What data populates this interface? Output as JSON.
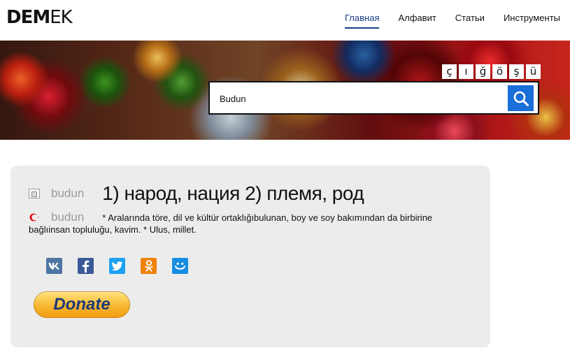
{
  "header": {
    "logo_bold": "DEM",
    "logo_light": "EK",
    "nav": [
      {
        "label": "Главная",
        "active": true
      },
      {
        "label": "Алфавит",
        "active": false
      },
      {
        "label": "Статьи",
        "active": false
      },
      {
        "label": "Инструменты",
        "active": false
      }
    ]
  },
  "special_letters": [
    "ç",
    "ı",
    "ğ",
    "ö",
    "ş",
    "ü"
  ],
  "search": {
    "value": "Budun",
    "button_icon": "search-icon"
  },
  "entry": {
    "ru_word": "budun",
    "ru_translation": "1) народ, нация 2) племя, род",
    "tr_word": "budun",
    "tr_definition": "* Aralarında töre, dil ve kültür ortaklığıbulunan, boy ve soy bakımından da birbirine bağlıinsan topluluğu, kavim. * Ulus, millet."
  },
  "social": [
    {
      "name": "vk",
      "glyph": "вк",
      "color": "#4c75a3"
    },
    {
      "name": "facebook",
      "glyph": "f",
      "color": "#3b5998"
    },
    {
      "name": "twitter",
      "glyph": "t",
      "color": "#1da1f2"
    },
    {
      "name": "odnoklassniki",
      "glyph": "ok",
      "color": "#ee8208"
    },
    {
      "name": "moi-mir",
      "glyph": "mm",
      "color": "#168de2"
    }
  ],
  "donate_label": "Donate",
  "colors": {
    "accent": "#1a3d8a",
    "search_button": "#1a6fd8",
    "card_bg": "#ececec"
  }
}
